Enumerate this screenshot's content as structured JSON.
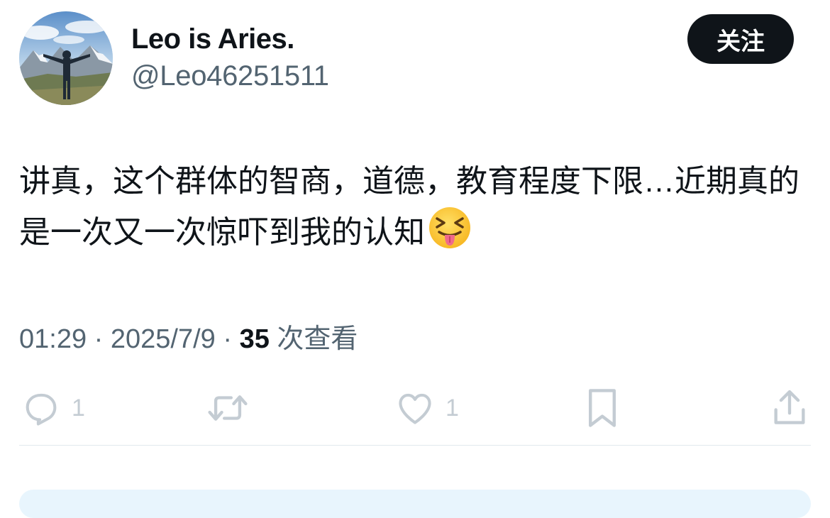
{
  "author": {
    "display_name": "Leo is Aries.",
    "handle": "@Leo46251511"
  },
  "follow_button": {
    "label": "关注"
  },
  "tweet": {
    "text": "讲真，这个群体的智商，道德，教育程度下限…近期真的是一次又一次惊吓到我的认知",
    "emoji": "😝"
  },
  "meta": {
    "time": "01:29",
    "separator": "·",
    "date": "2025/7/9",
    "views_count": "35",
    "views_label": "次查看"
  },
  "actions": {
    "reply": {
      "icon": "reply-icon",
      "count": "1"
    },
    "retweet": {
      "icon": "retweet-icon",
      "count": ""
    },
    "like": {
      "icon": "heart-icon",
      "count": "1"
    },
    "bookmark": {
      "icon": "bookmark-icon"
    },
    "share": {
      "icon": "share-icon"
    }
  },
  "colors": {
    "text_primary": "#0f1419",
    "text_secondary": "#536471",
    "icon_muted": "#c4ccd3",
    "button_bg": "#0f1419"
  }
}
